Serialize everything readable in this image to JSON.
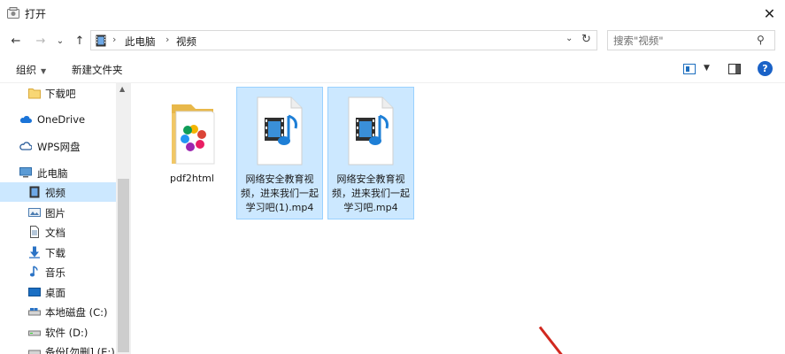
{
  "window": {
    "title": "打开"
  },
  "nav": {
    "back_label": "←",
    "forward_label": "→",
    "recent_label": "⌄",
    "up_label": "↑",
    "breadcrumb": [
      "此电脑",
      "视频"
    ],
    "search_placeholder": "搜索\"视频\""
  },
  "toolbar": {
    "organize_label": "组织",
    "new_folder_label": "新建文件夹",
    "help_label": "?"
  },
  "sidebar": {
    "items": [
      {
        "label": "下载吧",
        "icon": "folder-icon"
      },
      {
        "label": "OneDrive",
        "icon": "cloud-icon"
      },
      {
        "label": "WPS网盘",
        "icon": "wps-cloud-icon"
      },
      {
        "label": "此电脑",
        "icon": "computer-icon"
      },
      {
        "label": "视频",
        "icon": "video-icon",
        "selected": true
      },
      {
        "label": "图片",
        "icon": "pictures-icon"
      },
      {
        "label": "文档",
        "icon": "documents-icon"
      },
      {
        "label": "下载",
        "icon": "download-icon"
      },
      {
        "label": "音乐",
        "icon": "music-icon"
      },
      {
        "label": "桌面",
        "icon": "desktop-icon"
      },
      {
        "label": "本地磁盘 (C:)",
        "icon": "drive-c-icon"
      },
      {
        "label": "软件 (D:)",
        "icon": "drive-d-icon"
      },
      {
        "label": "备份[勿删] (E:)",
        "icon": "drive-e-icon"
      }
    ]
  },
  "files": [
    {
      "name": "pdf2html",
      "type": "folder",
      "selected": false
    },
    {
      "name": "网络安全教育视频，进来我们一起学习吧(1).mp4",
      "type": "mp4",
      "selected": true
    },
    {
      "name": "网络安全教育视频，进来我们一起学习吧.mp4",
      "type": "mp4",
      "selected": true
    }
  ],
  "colors": {
    "selection_bg": "#cce8ff",
    "selection_border": "#99d1ff",
    "accent": "#1a62c7",
    "annotation": "#d1281f"
  }
}
